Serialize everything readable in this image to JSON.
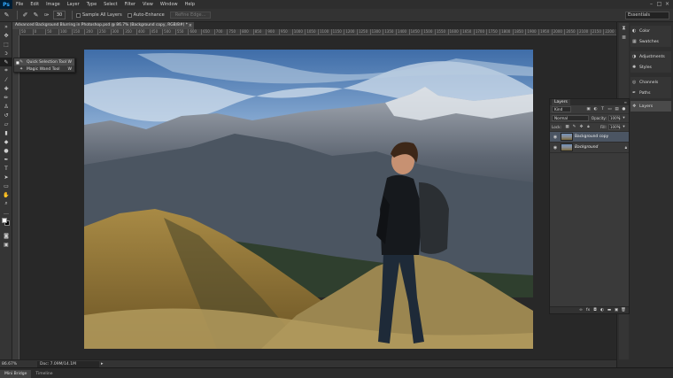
{
  "app": {
    "logo": "Ps"
  },
  "menu": [
    "File",
    "Edit",
    "Image",
    "Layer",
    "Type",
    "Select",
    "Filter",
    "View",
    "Window",
    "Help"
  ],
  "window_controls": [
    "–",
    "□",
    "×"
  ],
  "options_bar": {
    "brush_size": "30",
    "sample_all_layers_label": "Sample All Layers",
    "auto_enhance_label": "Auto-Enhance",
    "refine_edge_label": "Refine Edge...",
    "workspace": "Essentials"
  },
  "document_tab": {
    "title": "Advanced Background Blurring in Photoshop.psd @ 86.7% (Background copy, RGB/8#) *",
    "close": "×"
  },
  "ruler_ticks": [
    "50",
    "0",
    "50",
    "100",
    "150",
    "200",
    "250",
    "300",
    "350",
    "400",
    "450",
    "500",
    "550",
    "600",
    "650",
    "700",
    "750",
    "800",
    "850",
    "900",
    "950",
    "1000",
    "1050",
    "1100",
    "1150",
    "1200",
    "1250",
    "1300",
    "1350",
    "1400",
    "1450",
    "1500",
    "1550",
    "1600",
    "1650",
    "1700",
    "1750",
    "1800",
    "1850",
    "1900",
    "1950",
    "2000",
    "2050",
    "2100",
    "2150",
    "2200"
  ],
  "tool_flyout": {
    "items": [
      {
        "label": "Quick Selection Tool",
        "shortcut": "W",
        "selected": true
      },
      {
        "label": "Magic Wand Tool",
        "shortcut": "W",
        "selected": false
      }
    ]
  },
  "status_bar": {
    "zoom": "86.67%",
    "doc_info": "Doc: 7.09M/14.1M"
  },
  "bottom_tabs": [
    "Mini Bridge",
    "Timeline"
  ],
  "dock": {
    "group1": [
      {
        "icon": "color-icon",
        "label": "Color"
      },
      {
        "icon": "swatches-icon",
        "label": "Swatches"
      }
    ],
    "group2": [
      {
        "icon": "adjustments-icon",
        "label": "Adjustments"
      },
      {
        "icon": "styles-icon",
        "label": "Styles"
      }
    ],
    "group3": [
      {
        "icon": "channels-icon",
        "label": "Channels"
      },
      {
        "icon": "paths-icon",
        "label": "Paths"
      }
    ],
    "group4": [
      {
        "icon": "layers-icon",
        "label": "Layers"
      }
    ]
  },
  "layers_panel": {
    "tab": "Layers",
    "filter_kind": "Kind",
    "blend_mode": "Normal",
    "opacity_label": "Opacity:",
    "opacity_value": "100%",
    "lock_label": "Lock:",
    "fill_label": "Fill:",
    "fill_value": "100%",
    "layers": [
      {
        "name": "Background copy",
        "selected": true,
        "italic": false
      },
      {
        "name": "Background",
        "selected": false,
        "italic": true
      }
    ]
  },
  "accent_colors": {
    "ps_blue": "#31a8ff",
    "selection": "#4b5563"
  }
}
